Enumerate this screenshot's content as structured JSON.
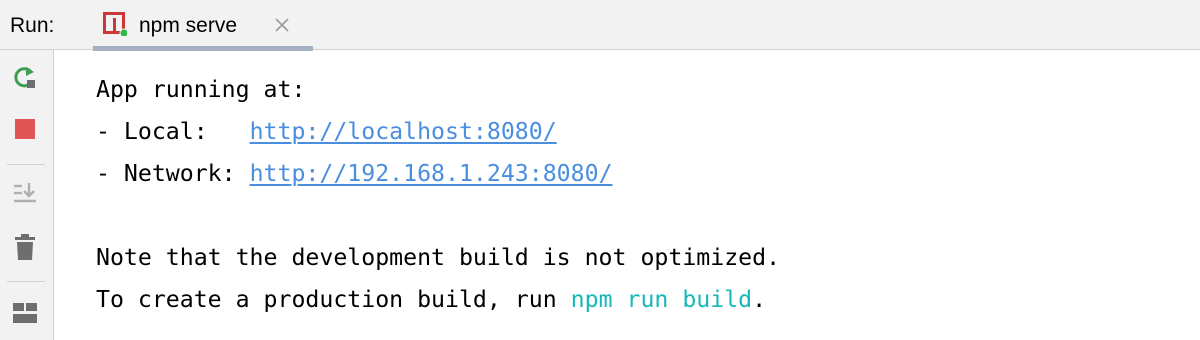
{
  "header": {
    "run_label": "Run:",
    "tab": {
      "label": "npm serve",
      "icon": "npm-run-config-icon",
      "status_dot_color": "#2fb843",
      "close_icon": "close-icon"
    }
  },
  "toolbar": {
    "items": [
      {
        "name": "rerun-icon",
        "color": "#3c9e52"
      },
      {
        "name": "stop-icon",
        "color": "#e05555"
      },
      {
        "name": "scroll-to-end-icon",
        "color": "#b0b0b0"
      },
      {
        "name": "clear-all-icon",
        "color": "#6e6e6e"
      },
      {
        "name": "layout-icon",
        "color": "#6e6e6e"
      }
    ]
  },
  "console": {
    "line1": "App running at:",
    "line2_prefix": "- Local:   ",
    "line2_link": "http://localhost:8080/",
    "line3_prefix": "- Network: ",
    "line3_link": "http://192.168.1.243:8080/",
    "line5": "Note that the development build is not optimized.",
    "line6_prefix": "To create a production build, run ",
    "line6_command": "npm run build",
    "line6_suffix": ".",
    "link_color": "#4a8ee0",
    "command_color": "#18b8b8"
  }
}
